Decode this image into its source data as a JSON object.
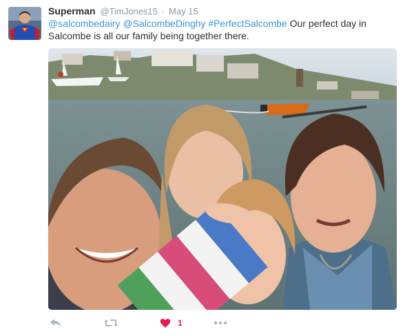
{
  "tweet": {
    "fullname": "Superman",
    "handle": "@TimJones15",
    "separator": "·",
    "time": "May 15",
    "text_links": [
      "@salcombedairy",
      "@SalcombeDinghy",
      "#PerfectSalcombe"
    ],
    "text_rest": "Our perfect day in Salcombe is all our family being together there.",
    "like_count": "1"
  },
  "icons": {
    "reply": "reply-icon",
    "retweet": "retweet-icon",
    "like": "heart-icon",
    "more": "more-icon"
  },
  "colors": {
    "link": "#3b94d9",
    "muted": "#8899a6",
    "like": "#e81c4f",
    "text": "#292f33"
  }
}
